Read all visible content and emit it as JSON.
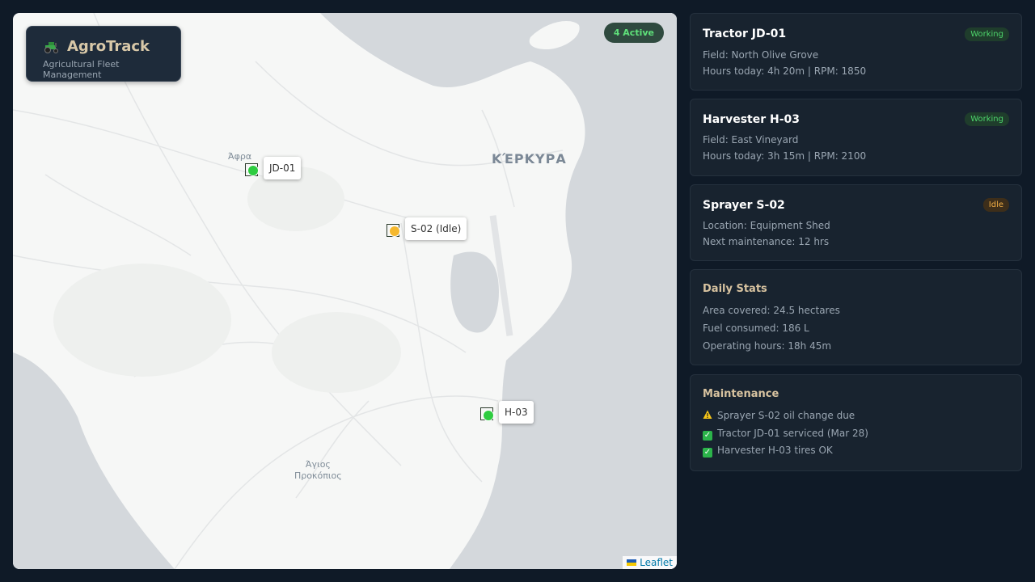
{
  "brand": {
    "title": "AgroTrack",
    "subtitle": "Agricultural Fleet Management"
  },
  "map": {
    "active_badge": "4 Active",
    "labels": {
      "afra": "Άφρα",
      "kerkyra": "ΚΈΡΚΥΡΑ",
      "agios_line1": "Άγιος",
      "agios_line2": "Προκόπιος"
    },
    "markers": [
      {
        "id": "JD-01",
        "label": "JD-01",
        "color": "#2ecc40"
      },
      {
        "id": "S-02",
        "label": "S-02 (Idle)",
        "color": "#f5b82e"
      },
      {
        "id": "H-03",
        "label": "H-03",
        "color": "#2ecc40"
      }
    ],
    "attribution": "Leaflet"
  },
  "vehicles": [
    {
      "name": "Tractor JD-01",
      "status": "Working",
      "line1": "Field: North Olive Grove",
      "line2": "Hours today: 4h 20m | RPM: 1850"
    },
    {
      "name": "Harvester H-03",
      "status": "Working",
      "line1": "Field: East Vineyard",
      "line2": "Hours today: 3h 15m | RPM: 2100"
    },
    {
      "name": "Sprayer S-02",
      "status": "Idle",
      "line1": "Location: Equipment Shed",
      "line2": "Next maintenance: 12 hrs"
    }
  ],
  "daily_stats": {
    "title": "Daily Stats",
    "lines": [
      "Area covered: 24.5 hectares",
      "Fuel consumed: 186 L",
      "Operating hours: 18h 45m"
    ]
  },
  "maintenance": {
    "title": "Maintenance",
    "items": [
      {
        "icon": "warning-icon",
        "text": "Sprayer S-02 oil change due"
      },
      {
        "icon": "check-icon",
        "text": "Tractor JD-01 serviced (Mar 28)"
      },
      {
        "icon": "check-icon",
        "text": "Harvester H-03 tires OK"
      }
    ]
  },
  "colors": {
    "working": "#4dd46b",
    "idle": "#f0ad45",
    "accent": "#d8c3a0"
  }
}
